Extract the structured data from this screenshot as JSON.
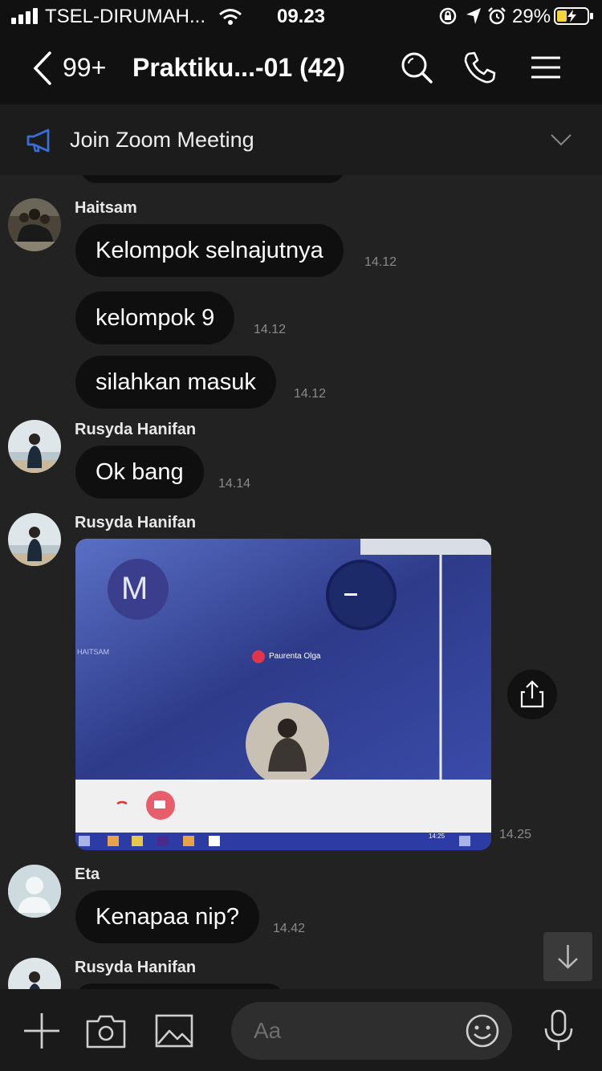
{
  "status_bar": {
    "carrier": "TSEL-DIRUMAH...",
    "time": "09.23",
    "battery": "29%"
  },
  "header": {
    "unread_count": "99+",
    "title": "Praktiku...-01 (42)"
  },
  "announcement": {
    "text": "Join Zoom Meeting"
  },
  "messages": [
    {
      "sender": "Haitsam",
      "text": "Kelompok selnajutnya",
      "time": "14.12"
    },
    {
      "text": "kelompok 9",
      "time": "14.12"
    },
    {
      "text": "silahkan masuk",
      "time": "14.12"
    },
    {
      "sender": "Rusyda Hanifan",
      "text": "Ok bang",
      "time": "14.14"
    },
    {
      "sender": "Rusyda Hanifan",
      "type": "image",
      "time": "14.25",
      "image_text": {
        "avatar_letter": "M",
        "left_name": "HAITSAM",
        "mic_name": "Paurenta Olga",
        "clock": "14:25"
      }
    },
    {
      "sender": "Eta",
      "text": "Kenapaa nip?",
      "time": "14.42"
    },
    {
      "sender": "Rusyda Hanifan"
    }
  ],
  "input": {
    "placeholder": "Aa"
  },
  "icons": [
    "back-chevron-icon",
    "search-icon",
    "phone-icon",
    "menu-icon",
    "megaphone-icon",
    "chevron-down-icon",
    "share-icon",
    "arrow-down-icon",
    "plus-icon",
    "camera-icon",
    "image-icon",
    "emoji-icon",
    "microphone-icon"
  ],
  "colors": {
    "background": "#222222",
    "header": "#111111",
    "bubble": "#0f0f0f",
    "accent_megaphone": "#3b6fd6"
  }
}
